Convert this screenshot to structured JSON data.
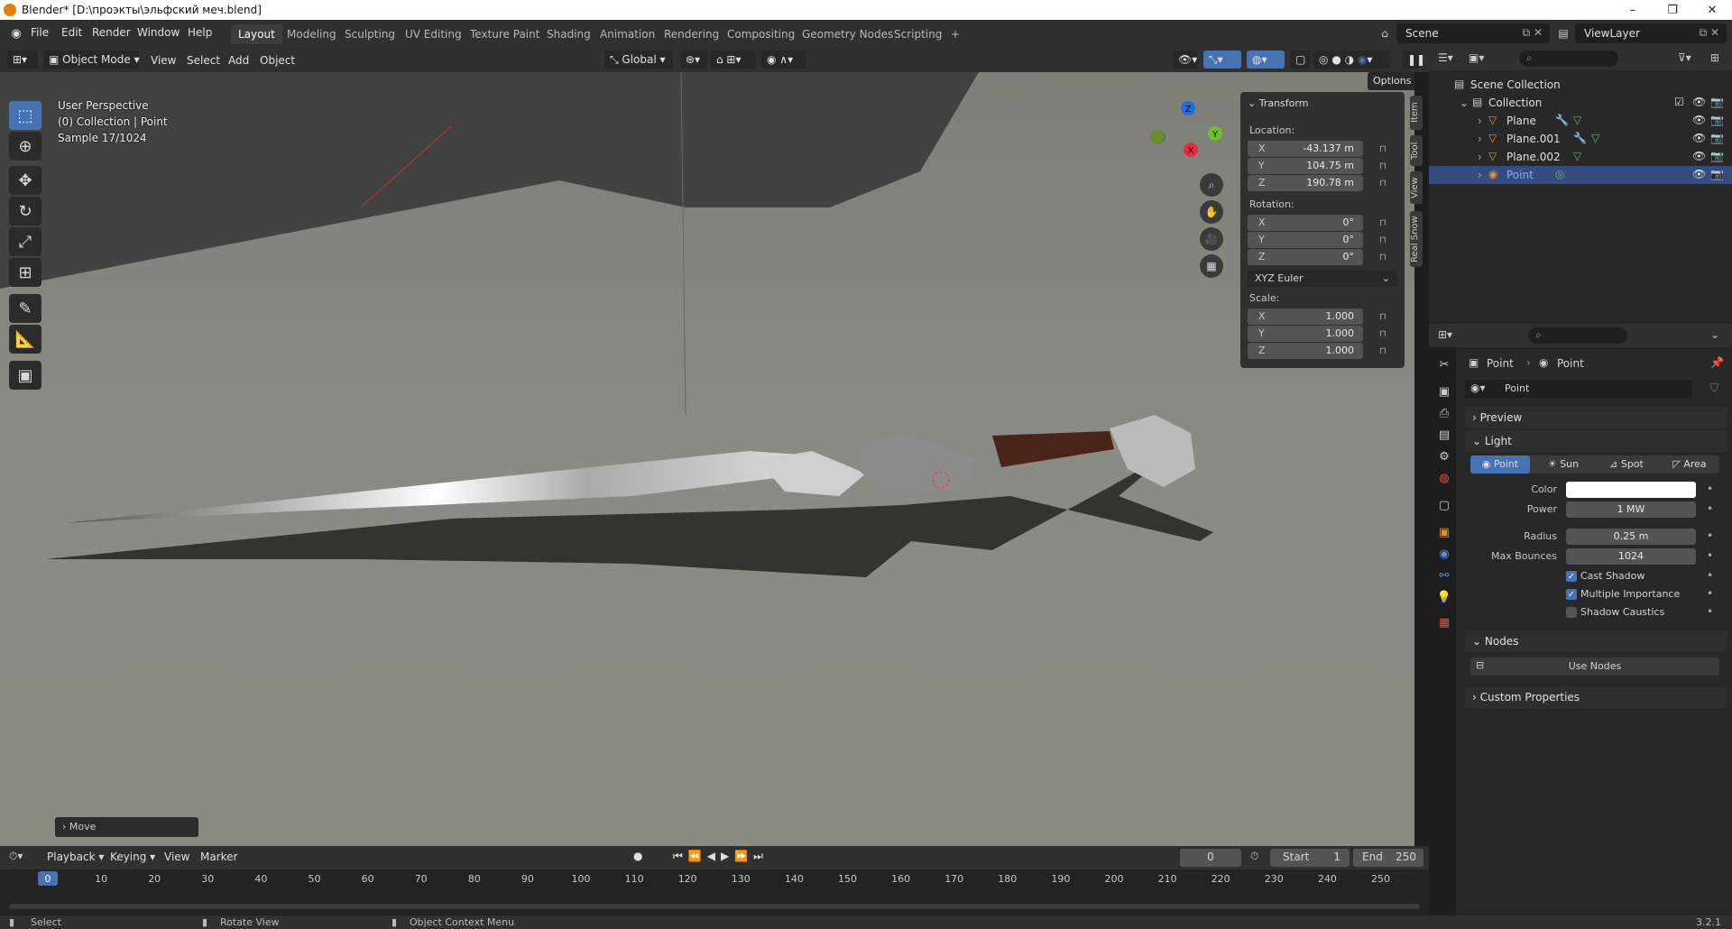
{
  "window": {
    "title": "Blender* [D:\\проэкты\\эльфский меч.blend]"
  },
  "topmenu": {
    "items": [
      "File",
      "Edit",
      "Render",
      "Window",
      "Help"
    ],
    "workspaces": [
      "Layout",
      "Modeling",
      "Sculpting",
      "UV Editing",
      "Texture Paint",
      "Shading",
      "Animation",
      "Rendering",
      "Compositing",
      "Geometry Nodes",
      "Scripting"
    ],
    "add_tab": "+",
    "scene": "Scene",
    "view_layer": "ViewLayer"
  },
  "viewport_header": {
    "mode": "Object Mode",
    "menus": [
      "View",
      "Select",
      "Add",
      "Object"
    ],
    "orientation": "Global",
    "options": "Options"
  },
  "viewport": {
    "info_lines": [
      "User Perspective",
      "(0) Collection | Point",
      "Sample 17/1024"
    ],
    "last_op": "Move",
    "gizmo": {
      "x": "X",
      "y": "Y",
      "z": "Z"
    }
  },
  "npanel": {
    "tabs": [
      "Item",
      "Tool",
      "View",
      "Real Snow"
    ],
    "header": "Transform",
    "location_label": "Location:",
    "location": [
      {
        "axis": "X",
        "value": "-43.137 m"
      },
      {
        "axis": "Y",
        "value": "104.75 m"
      },
      {
        "axis": "Z",
        "value": "190.78 m"
      }
    ],
    "rotation_label": "Rotation:",
    "rotation": [
      {
        "axis": "X",
        "value": "0°"
      },
      {
        "axis": "Y",
        "value": "0°"
      },
      {
        "axis": "Z",
        "value": "0°"
      }
    ],
    "rotation_mode": "XYZ Euler",
    "scale_label": "Scale:",
    "scale": [
      {
        "axis": "X",
        "value": "1.000"
      },
      {
        "axis": "Y",
        "value": "1.000"
      },
      {
        "axis": "Z",
        "value": "1.000"
      }
    ]
  },
  "outliner": {
    "scene_collection": "Scene Collection",
    "collection": "Collection",
    "objects": [
      "Plane",
      "Plane.001",
      "Plane.002",
      "Point"
    ],
    "selected": "Point"
  },
  "properties": {
    "breadcrumb": [
      "Point",
      "Point"
    ],
    "datablock": "Point",
    "sections": {
      "preview": "Preview",
      "light": "Light",
      "nodes": "Nodes",
      "custom": "Custom Properties"
    },
    "light_types": [
      "Point",
      "Sun",
      "Spot",
      "Area"
    ],
    "active_light_type": "Point",
    "color_label": "Color",
    "color_value": "#ffffff",
    "power_label": "Power",
    "power": "1 MW",
    "radius_label": "Radius",
    "radius": "0.25 m",
    "bounces_label": "Max Bounces",
    "bounces": "1024",
    "checkboxes": [
      {
        "label": "Cast Shadow",
        "checked": true
      },
      {
        "label": "Multiple Importance",
        "checked": true
      },
      {
        "label": "Shadow Caustics",
        "checked": false
      }
    ],
    "use_nodes": "Use Nodes"
  },
  "timeline": {
    "menus": [
      "Playback",
      "Keying",
      "View",
      "Marker"
    ],
    "current_frame": "0",
    "start_label": "Start",
    "start": "1",
    "end_label": "End",
    "end": "250",
    "ticks": [
      "0",
      "10",
      "20",
      "30",
      "40",
      "50",
      "60",
      "70",
      "80",
      "90",
      "100",
      "110",
      "120",
      "130",
      "140",
      "150",
      "160",
      "170",
      "180",
      "190",
      "200",
      "210",
      "220",
      "230",
      "240",
      "250"
    ]
  },
  "statusbar": {
    "select": "Select",
    "rotate": "Rotate View",
    "context": "Object Context Menu",
    "version": "3.2.1"
  },
  "colors": {
    "accent": "#4772b3",
    "selected_row": "#334d80",
    "header": "#303030",
    "panel": "#282828"
  }
}
